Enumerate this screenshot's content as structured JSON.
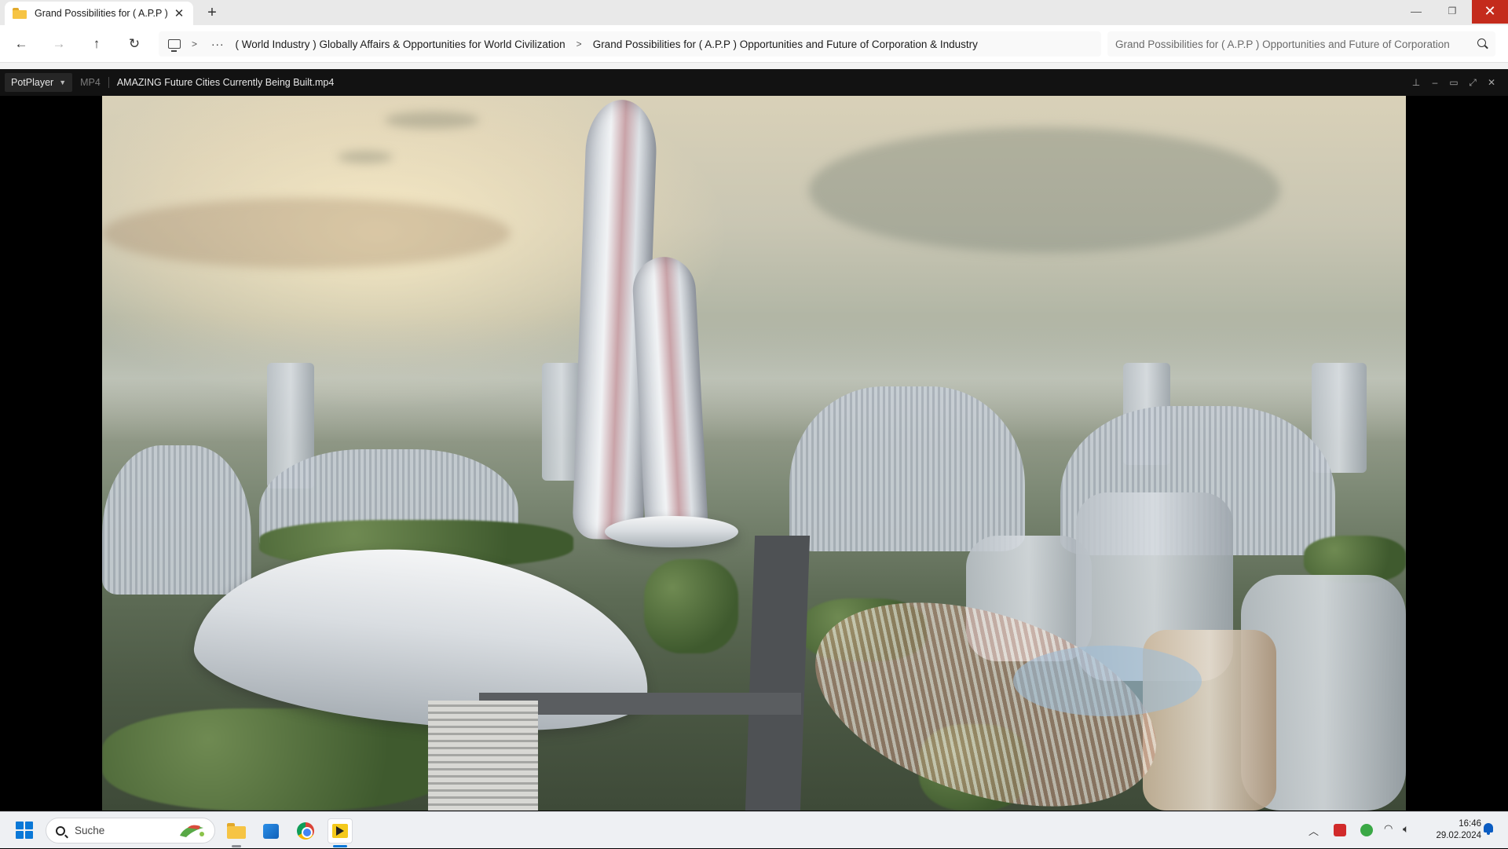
{
  "explorer": {
    "tab_title": "Grand Possibilities for ( A.P.P )",
    "breadcrumb": [
      "( World Industry ) Globally Affairs & Opportunities for World Civilization",
      "Grand Possibilities for ( A.P.P ) Opportunities and Future of Corporation & Industry"
    ],
    "search_text": "Grand Possibilities for ( A.P.P ) Opportunities and Future of Corporation"
  },
  "player": {
    "menu_label": "PotPlayer",
    "format": "MP4",
    "filename": "AMAZING Future Cities Currently Being Built.mp4"
  },
  "taskbar": {
    "search_placeholder": "Suche",
    "time": "16:46",
    "date": "29.02.2024"
  },
  "colors": {
    "accent": "#0a78d7",
    "close_red": "#c42b1c",
    "folder_yellow": "#f6c444"
  },
  "icons": {
    "tab": "folder-icon",
    "back": "arrow-left-icon",
    "forward": "arrow-right-icon",
    "up": "arrow-up-icon",
    "refresh": "refresh-icon",
    "location": "monitor-icon",
    "search": "search-icon"
  }
}
